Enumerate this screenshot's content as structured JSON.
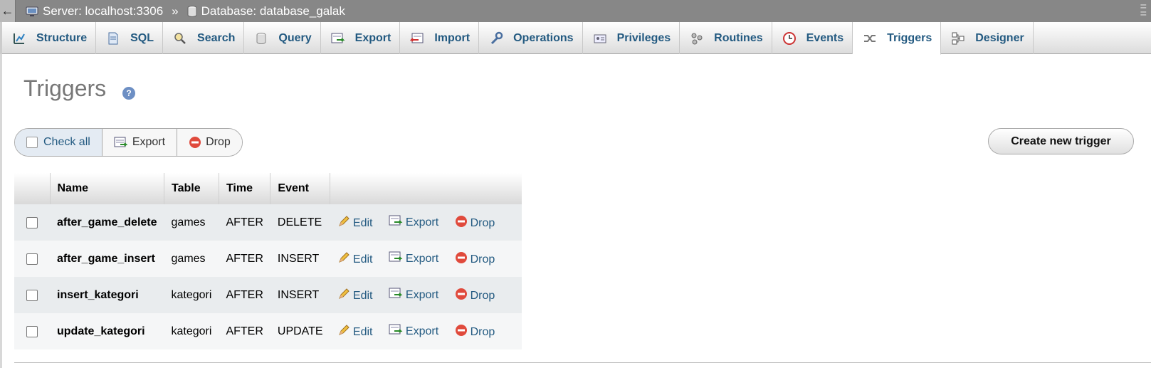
{
  "breadcrumb": {
    "back_glyph": "←",
    "server": "Server: localhost:3306",
    "separator": "»",
    "database": "Database: database_galak"
  },
  "tabs": [
    {
      "label": "Structure",
      "icon": "structure-icon"
    },
    {
      "label": "SQL",
      "icon": "sql-icon"
    },
    {
      "label": "Search",
      "icon": "search-icon"
    },
    {
      "label": "Query",
      "icon": "query-icon"
    },
    {
      "label": "Export",
      "icon": "export-icon"
    },
    {
      "label": "Import",
      "icon": "import-icon"
    },
    {
      "label": "Operations",
      "icon": "wrench-icon"
    },
    {
      "label": "Privileges",
      "icon": "privileges-icon"
    },
    {
      "label": "Routines",
      "icon": "routines-icon"
    },
    {
      "label": "Events",
      "icon": "events-icon"
    },
    {
      "label": "Triggers",
      "icon": "triggers-icon",
      "active": true
    },
    {
      "label": "Designer",
      "icon": "designer-icon"
    }
  ],
  "page": {
    "title": "Triggers",
    "help_glyph": "?"
  },
  "actions": {
    "check_all": "Check all",
    "export": "Export",
    "drop": "Drop",
    "create": "Create new trigger"
  },
  "table": {
    "headers": [
      "Name",
      "Table",
      "Time",
      "Event"
    ],
    "rows": [
      {
        "name": "after_game_delete",
        "table": "games",
        "time": "AFTER",
        "event": "DELETE"
      },
      {
        "name": "after_game_insert",
        "table": "games",
        "time": "AFTER",
        "event": "INSERT"
      },
      {
        "name": "insert_kategori",
        "table": "kategori",
        "time": "AFTER",
        "event": "INSERT"
      },
      {
        "name": "update_kategori",
        "table": "kategori",
        "time": "AFTER",
        "event": "UPDATE"
      }
    ],
    "row_actions": {
      "edit": "Edit",
      "export": "Export",
      "drop": "Drop"
    }
  }
}
